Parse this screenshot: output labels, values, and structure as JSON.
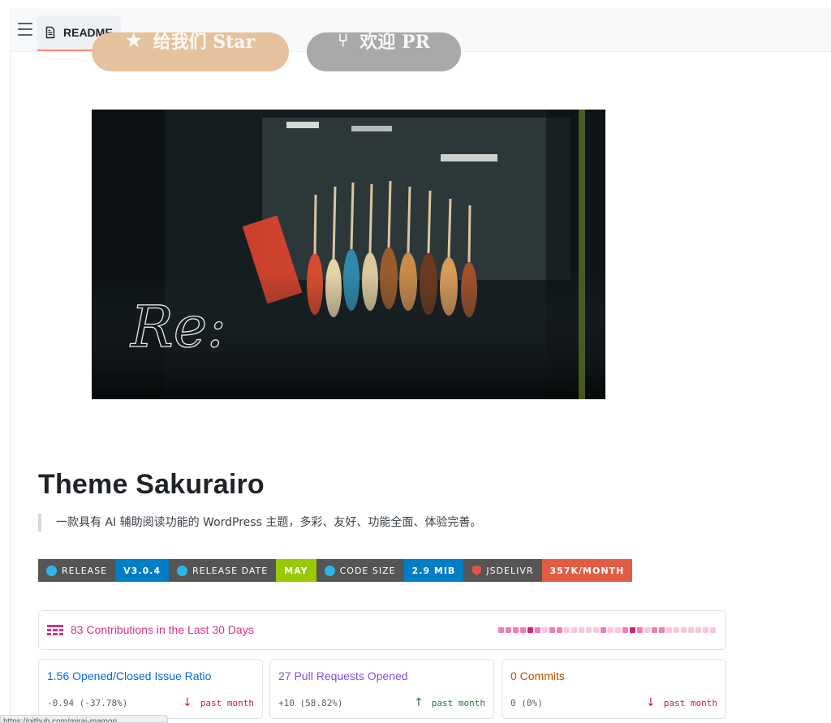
{
  "tab": {
    "label": "README"
  },
  "buttons": {
    "star_label": "给我们 Star",
    "pr_label": "欢迎 PR"
  },
  "banner": {
    "signature": "Re:"
  },
  "title": "Theme Sakurairo",
  "description": "一款具有 AI 辅助阅读功能的 WordPress 主题，多彩、友好、功能全面、体验完善。",
  "badges": [
    {
      "label": "RELEASE",
      "value": "V3.0.4",
      "color": "#007ec6",
      "icon": "logo-icon"
    },
    {
      "label": "RELEASE DATE",
      "value": "MAY",
      "color": "#97ca00",
      "icon": "logo-icon"
    },
    {
      "label": "CODE SIZE",
      "value": "2.9 MIB",
      "color": "#007ec6",
      "icon": "logo-icon"
    },
    {
      "label": "JSDELIVR",
      "value": "357K/MONTH",
      "color": "#e05d44",
      "icon": "shield-icon"
    }
  ],
  "contributions": {
    "text": "83 Contributions in the Last 30 Days",
    "days": [
      2,
      2,
      2,
      2,
      3,
      2,
      1,
      2,
      2,
      1,
      1,
      1,
      1,
      1,
      2,
      1,
      1,
      2,
      3,
      2,
      1,
      2,
      2,
      1,
      1,
      1,
      1,
      1,
      1,
      1
    ]
  },
  "stats": [
    {
      "title": "1.56 Opened/Closed Issue Ratio",
      "delta": "-0.94 (-37.78%)",
      "trend": "past month",
      "direction": "down",
      "title_color": "#0969da",
      "trend_color": "#cf222e"
    },
    {
      "title": "27 Pull Requests Opened",
      "delta": "+10 (58.82%)",
      "trend": "past month",
      "direction": "up",
      "title_color": "#8250df",
      "trend_color": "#1a7f37"
    },
    {
      "title": "0 Commits",
      "delta": "0 (0%)",
      "trend": "past month",
      "direction": "down",
      "title_color": "#bc4c00",
      "trend_color": "#cf222e"
    }
  ],
  "status_bar": {
    "text": "https://github.com/mirai-mamori"
  }
}
